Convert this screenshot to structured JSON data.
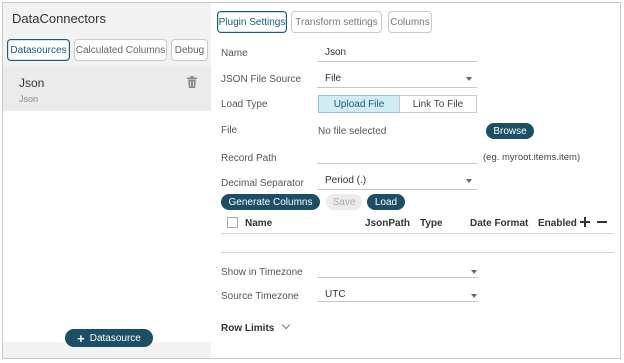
{
  "app": {
    "title": "DataConnectors"
  },
  "left_tabs": [
    "Datasources",
    "Calculated Columns",
    "Debug"
  ],
  "datasource": {
    "name": "Json",
    "type": "Json"
  },
  "add_datasource_label": "Datasource",
  "right_tabs": [
    "Plugin Settings",
    "Transform settings",
    "Columns"
  ],
  "form": {
    "name_label": "Name",
    "name_value": "Json",
    "source_label": "JSON File Source",
    "source_value": "File",
    "load_type_label": "Load Type",
    "load_type_options": [
      "Upload File",
      "Link To File"
    ],
    "file_label": "File",
    "file_value": "No file selected",
    "browse_label": "Browse",
    "record_path_label": "Record Path",
    "record_path_hint": "(eg. myroot.items.item)",
    "decimal_label": "Decimal Separator",
    "decimal_value": "Period (.)"
  },
  "actions": {
    "generate": "Generate Columns",
    "save": "Save",
    "load": "Load"
  },
  "columns_table": {
    "headers": [
      "Name",
      "JsonPath",
      "Type",
      "Date Format",
      "Enabled"
    ]
  },
  "timezone": {
    "show_label": "Show in Timezone",
    "show_value": "",
    "source_label": "Source Timezone",
    "source_value": "UTC"
  },
  "row_limits_label": "Row Limits",
  "colors": {
    "accent": "#1c4e66",
    "active_segment": "#d2ecf4",
    "panel_bg": "#f2f2f2"
  }
}
